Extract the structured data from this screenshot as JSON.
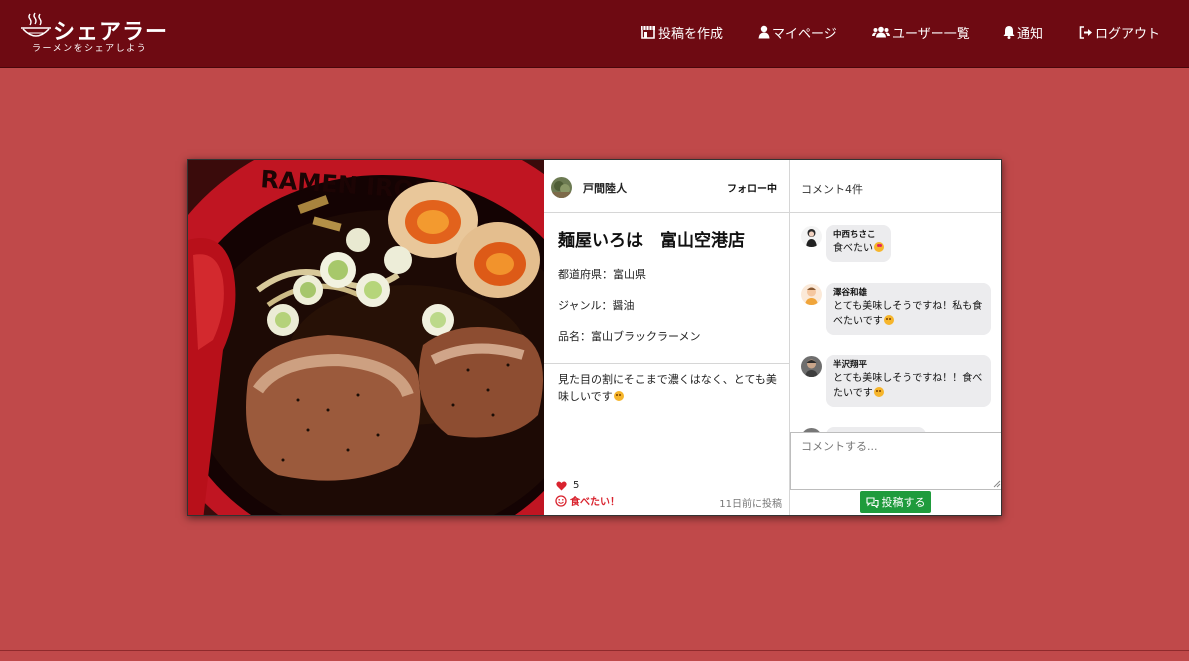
{
  "brand": {
    "title": "シェアラー",
    "subtitle": "ラーメンをシェアしよう"
  },
  "nav": {
    "items": [
      {
        "label": "投稿を作成",
        "icon": "store-icon"
      },
      {
        "label": "マイページ",
        "icon": "user-icon"
      },
      {
        "label": "ユーザー一覧",
        "icon": "users-icon"
      },
      {
        "label": "通知",
        "icon": "bell-icon"
      },
      {
        "label": "ログアウト",
        "icon": "sign-out-icon"
      }
    ]
  },
  "colors": {
    "page_bg": "#c0494a",
    "header_bg": "#6e0a12",
    "accent_red": "#d9232e",
    "submit_green": "#1f9b3c"
  },
  "post": {
    "image_icon": "ramen-photo",
    "author": "戸間陸人",
    "follow_label": "フォロー中",
    "shop_name": "麺屋いろは　富山空港店",
    "prefecture": "都道府県：富山県",
    "genre": "ジャンル：醤油",
    "item": "品名：富山ブラックラーメン",
    "body": "見た目の割にそこまで濃くはなく、とても美味しいです",
    "likes_count": "5",
    "want_label": "食べたい！",
    "posted_at": "11日前に投稿"
  },
  "comments": {
    "count_label": "コメント4件",
    "items": [
      {
        "name": "中西ちさこ",
        "text": "食べたい"
      },
      {
        "name": "澤谷和雄",
        "text": "とても美味しそうですね！私も食べたいです"
      },
      {
        "name": "半沢翔平",
        "text": "とても美味しそうですね！！食べたいです"
      }
    ],
    "input_placeholder": "コメントする...",
    "submit_label": "投稿する"
  }
}
